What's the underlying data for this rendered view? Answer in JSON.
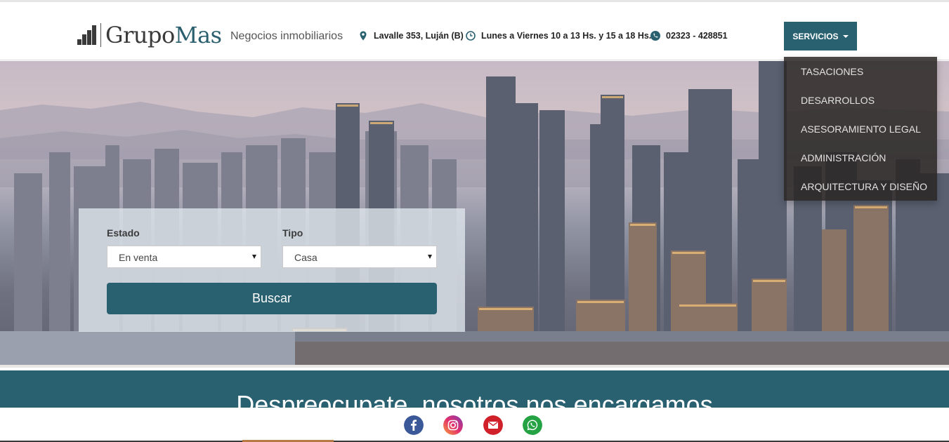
{
  "header": {
    "logo": {
      "grupo": "Grupo",
      "mas": "Mas"
    },
    "tagline": "Negocios inmobiliarios",
    "address": "Lavalle 353, Luján (B)",
    "hours": "Lunes a Viernes 10 a 13 Hs. y 15 a 18 Hs.",
    "phone": "02323 - 428851",
    "servicios_label": "SERVICIOS",
    "icons": {
      "address": "map-pin-icon",
      "hours": "clock-icon",
      "phone": "phone-icon"
    }
  },
  "servicios_menu": {
    "items": [
      {
        "label": "TASACIONES"
      },
      {
        "label": "DESARROLLOS"
      },
      {
        "label": "ASESORAMIENTO LEGAL"
      },
      {
        "label": "ADMINISTRACIÓN"
      },
      {
        "label": "ARQUITECTURA Y DISEÑO"
      }
    ]
  },
  "search": {
    "estado_label": "Estado",
    "estado_value": "En venta",
    "tipo_label": "Tipo",
    "tipo_value": "Casa",
    "button": "Buscar"
  },
  "band": {
    "title": "Despreocupate, nosotros nos encargamos"
  },
  "social": {
    "icons": [
      "facebook-icon",
      "instagram-icon",
      "email-icon",
      "whatsapp-icon"
    ]
  },
  "colors": {
    "brand": "#2a6170",
    "dropdown_bg": "#2a2624",
    "facebook": "#3b5998",
    "email": "#d0202a",
    "whatsapp": "#25a244"
  }
}
